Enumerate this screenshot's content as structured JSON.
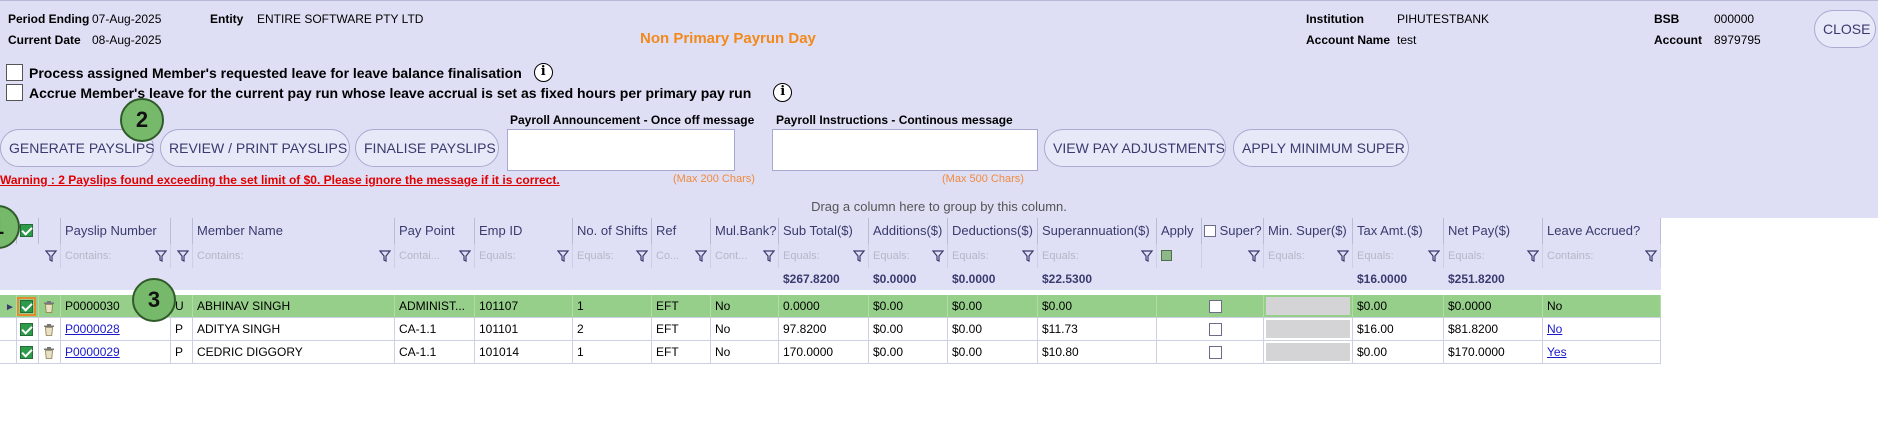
{
  "header": {
    "period_ending_label": "Period Ending",
    "period_ending_value": "07-Aug-2025",
    "current_date_label": "Current Date",
    "current_date_value": "08-Aug-2025",
    "entity_label": "Entity",
    "entity_value": "ENTIRE SOFTWARE PTY LTD",
    "payrun_type": "Non Primary Payrun Day",
    "institution_label": "Institution",
    "institution_value": "PIHUTESTBANK",
    "account_name_label": "Account Name",
    "account_name_value": "test",
    "bsb_label": "BSB",
    "bsb_value": "000000",
    "account_label": "Account",
    "account_value": "8979795",
    "close_label": "CLOSE"
  },
  "options": {
    "process_leave_label": "Process assigned Member's requested leave for leave balance finalisation",
    "accrue_leave_label": "Accrue Member's leave for the current pay run whose leave accrual is set as fixed hours per primary pay run",
    "info_glyph": "i"
  },
  "actions": {
    "generate": "GENERATE PAYSLIPS",
    "review": "REVIEW / PRINT PAYSLIPS",
    "finalise": "FINALISE PAYSLIPS",
    "view_adjustments": "VIEW PAY ADJUSTMENTS",
    "apply_min_super": "APPLY MINIMUM SUPER"
  },
  "messages": {
    "announcement_label": "Payroll Announcement - Once off message",
    "announcement_value": "",
    "announcement_max": "(Max 200 Chars)",
    "instructions_label": "Payroll Instructions - Continous message",
    "instructions_value": "",
    "instructions_max": "(Max 500 Chars)"
  },
  "warning": "Warning : 2 Payslips found exceeding the set limit of $0. Please ignore the message if it is correct.",
  "badges": {
    "b1": "1",
    "b2": "2",
    "b3": "3"
  },
  "grid": {
    "group_hint": "Drag a column here to group by this column.",
    "columns": {
      "payslip_number": "Payslip Number",
      "member_name": "Member Name",
      "pay_point": "Pay Point",
      "emp_id": "Emp ID",
      "shifts": "No. of Shifts",
      "ref": "Ref",
      "mul_bank": "Mul.Bank?",
      "sub_total": "Sub Total($)",
      "additions": "Additions($)",
      "deductions": "Deductions($)",
      "superannuation": "Superannuation($)",
      "apply": "Apply",
      "super": "Super?",
      "min_super": "Min. Super($)",
      "tax": "Tax Amt.($)",
      "net_pay": "Net Pay($)",
      "leave_accrued": "Leave Accrued?"
    },
    "filters": {
      "payslip_number": "Contains:",
      "member_name": "Contains:",
      "pay_point": "Contai...",
      "emp_id": "Equals:",
      "shifts": "Equals:",
      "ref": "Co...",
      "mul_bank": "Cont...",
      "sub_total": "Equals:",
      "additions": "Equals:",
      "deductions": "Equals:",
      "superannuation": "Equals:",
      "min_super": "Equals:",
      "tax": "Equals:",
      "net_pay": "Equals:",
      "leave_accrued": "Contains:"
    },
    "totals": {
      "sub_total": "$267.8200",
      "additions": "$0.0000",
      "deductions": "$0.0000",
      "superannuation": "$22.5300",
      "tax": "$16.0000",
      "net_pay": "$251.8200"
    },
    "rows": [
      {
        "flag": "U",
        "payslip_number": "P0000030",
        "member_name": "ABHINAV SINGH",
        "pay_point": "ADMINIST...",
        "emp_id": "101107",
        "shifts": "1",
        "ref": "EFT",
        "mul_bank": "No",
        "sub_total": "0.0000",
        "additions": "$0.00",
        "deductions": "$0.00",
        "superannuation": "$0.00",
        "tax": "$0.00",
        "net_pay": "$0.0000",
        "leave_accrued": "No"
      },
      {
        "flag": "P",
        "payslip_number": "P0000028",
        "member_name": "ADITYA SINGH",
        "pay_point": "CA-1.1",
        "emp_id": "101101",
        "shifts": "2",
        "ref": "EFT",
        "mul_bank": "No",
        "sub_total": "97.8200",
        "additions": "$0.00",
        "deductions": "$0.00",
        "superannuation": "$11.73",
        "tax": "$16.00",
        "net_pay": "$81.8200",
        "leave_accrued": "No"
      },
      {
        "flag": "P",
        "payslip_number": "P0000029",
        "member_name": "CEDRIC DIGGORY",
        "pay_point": "CA-1.1",
        "emp_id": "101014",
        "shifts": "1",
        "ref": "EFT",
        "mul_bank": "No",
        "sub_total": "170.0000",
        "additions": "$0.00",
        "deductions": "$0.00",
        "superannuation": "$10.80",
        "tax": "$0.00",
        "net_pay": "$170.0000",
        "leave_accrued": "Yes"
      }
    ]
  }
}
